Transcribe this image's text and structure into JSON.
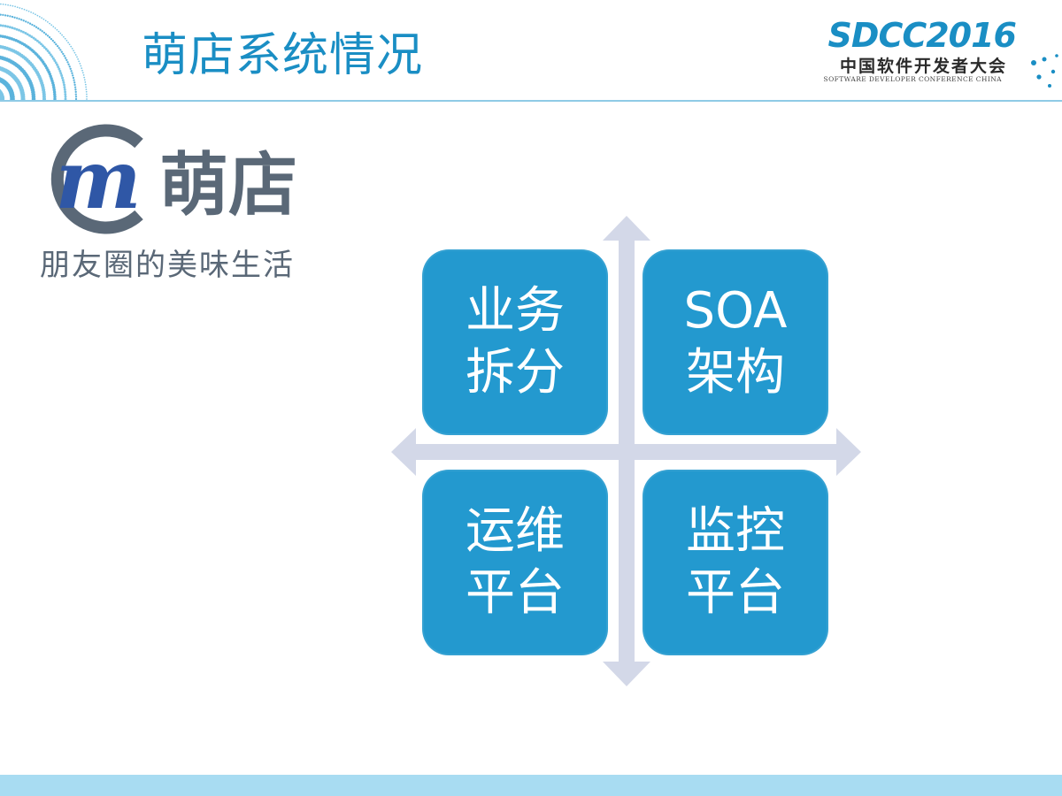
{
  "header": {
    "title": "萌店系统情况",
    "conference": {
      "name": "SDCC2016",
      "chinese_name": "中国软件开发者大会",
      "english_name": "SOFTWARE DEVELOPER CONFERENCE CHINA"
    }
  },
  "brand": {
    "logo_letter": "m",
    "name": "萌店",
    "tagline": "朋友圈的美味生活"
  },
  "diagram": {
    "tiles": [
      {
        "line1": "业务",
        "line2": "拆分"
      },
      {
        "line1": "SOA",
        "line2": "架构"
      },
      {
        "line1": "运维",
        "line2": "平台"
      },
      {
        "line1": "监控",
        "line2": "平台"
      }
    ]
  },
  "colors": {
    "accent": "#1a8ec4",
    "tile": "#2399cf",
    "arrow": "#d3d8e8",
    "brand_gray": "#5a6877",
    "footer": "#a8dcf2"
  }
}
